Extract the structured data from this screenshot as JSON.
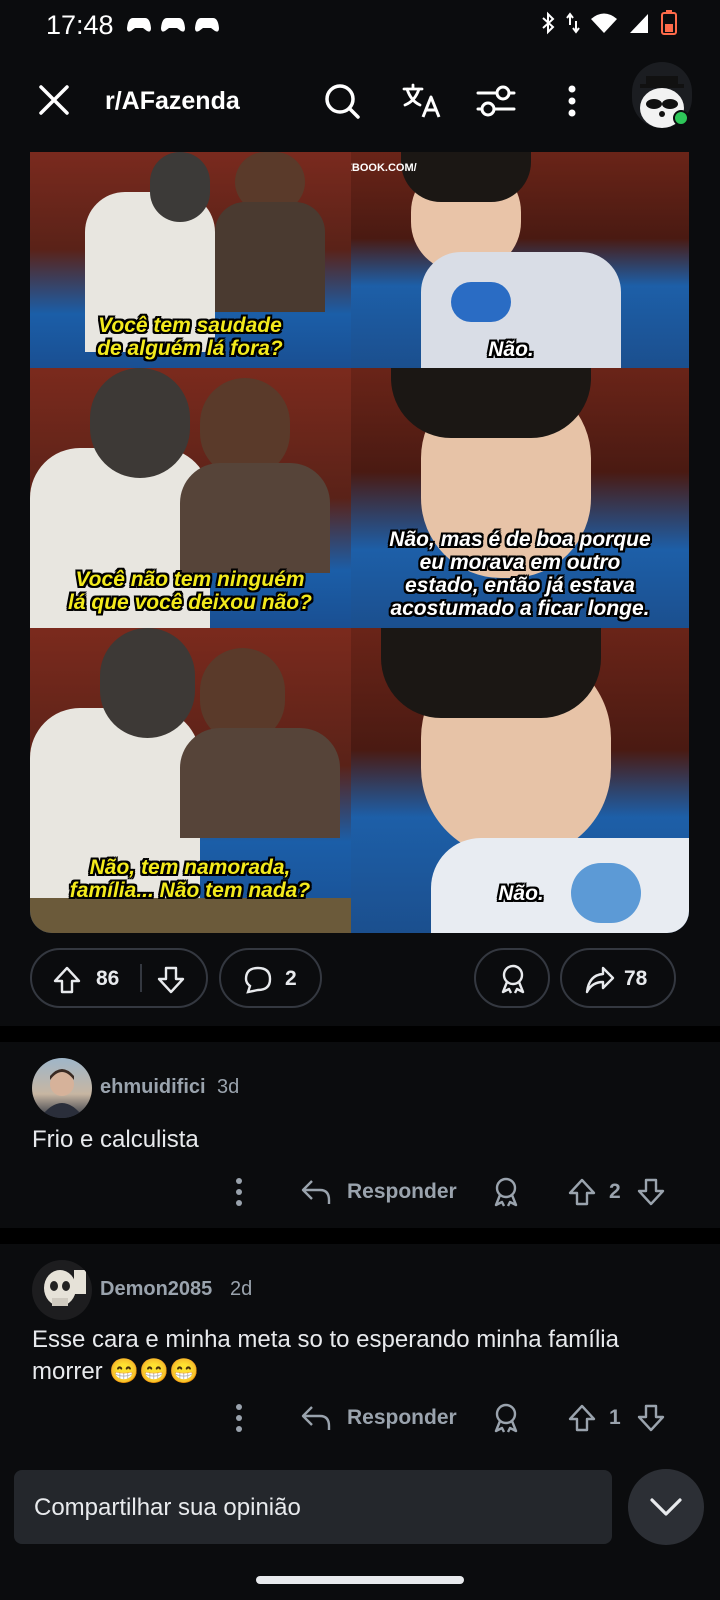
{
  "status_bar": {
    "time": "17:48",
    "notification_icons": [
      "game-controller-icon",
      "game-controller-icon",
      "game-controller-icon"
    ],
    "right_icons": [
      "bluetooth-icon",
      "data-arrows-icon",
      "wifi-icon",
      "signal-icon",
      "battery-icon"
    ]
  },
  "app_bar": {
    "subreddit": "r/AFazenda",
    "icons": [
      "close-icon",
      "search-icon",
      "translate-icon",
      "filter-icon",
      "more-vertical-icon",
      "user-avatar"
    ]
  },
  "post": {
    "image": {
      "watermark": "WWW.FACEBOOK.COM/",
      "panels": [
        {
          "caption": "Você tem saudade\nde alguém lá fora?"
        },
        {
          "caption": "Não."
        },
        {
          "caption": "Você não tem ninguém\nlá que você deixou não?"
        },
        {
          "caption": "Não, mas é de boa porque\neu morava em outro\nestado, então já estava\nacostumado a ficar longe."
        },
        {
          "caption": "Não, tem namorada,\nfamília... Não tem nada?"
        },
        {
          "caption": "Não."
        }
      ]
    },
    "votes": "86",
    "comments": "2",
    "shares": "78"
  },
  "comments": [
    {
      "user": "ehmuidifici",
      "age": "3d",
      "body": "Frio e calculista",
      "reply_label": "Responder",
      "votes": "2"
    },
    {
      "user": "Demon2085",
      "age": "2d",
      "body": "Esse cara e minha meta so to esperando minha família morrer 😁😁😁",
      "reply_label": "Responder",
      "votes": "1"
    }
  ],
  "composer": {
    "placeholder": "Compartilhar sua opinião"
  },
  "colors": {
    "background": "#0b0c0e",
    "caption_yellow": "#f3ea1c",
    "online": "#2ec759"
  }
}
